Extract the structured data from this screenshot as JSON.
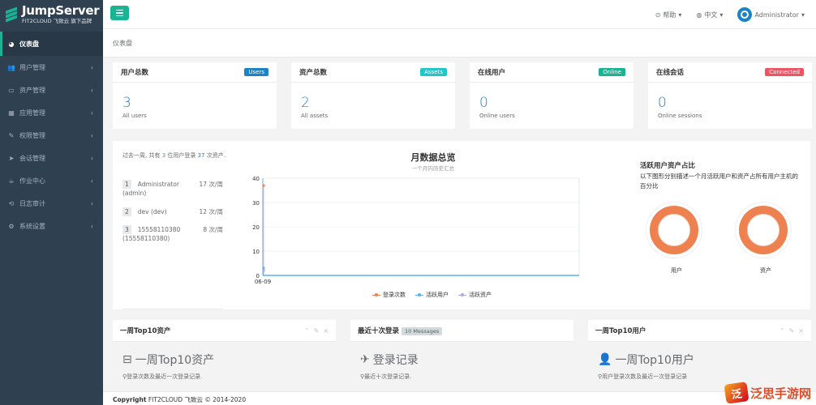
{
  "app": {
    "logo_title": "JumpServer",
    "logo_sub": "FIT2CLOUD 飞致云 旗下品牌"
  },
  "sidebar": {
    "items": [
      {
        "label": "仪表盘",
        "icon": "dashboard-icon",
        "glyph": "◕"
      },
      {
        "label": "用户管理",
        "icon": "users-icon",
        "glyph": "👥"
      },
      {
        "label": "资产管理",
        "icon": "inbox-icon",
        "glyph": "▭"
      },
      {
        "label": "应用管理",
        "icon": "grid-icon",
        "glyph": "▦"
      },
      {
        "label": "权限管理",
        "icon": "edit-icon",
        "glyph": "✎"
      },
      {
        "label": "会话管理",
        "icon": "rocket-icon",
        "glyph": "➤"
      },
      {
        "label": "作业中心",
        "icon": "coffee-icon",
        "glyph": "☕"
      },
      {
        "label": "日志审计",
        "icon": "history-icon",
        "glyph": "⟲"
      },
      {
        "label": "系统设置",
        "icon": "gears-icon",
        "glyph": "⚙"
      }
    ],
    "arrow": "‹"
  },
  "topbar": {
    "help": "帮助",
    "language": "中文",
    "user": "Administrator",
    "caret": "▾"
  },
  "breadcrumb": "仪表盘",
  "stats": [
    {
      "title": "用户总数",
      "badge": "Users",
      "badge_color": "#1c84c6",
      "value": "3",
      "sub": "All users"
    },
    {
      "title": "资产总数",
      "badge": "Assets",
      "badge_color": "#23c6c8",
      "value": "2",
      "sub": "All assets"
    },
    {
      "title": "在线用户",
      "badge": "Online",
      "badge_color": "#1ab394",
      "value": "0",
      "sub": "Online users"
    },
    {
      "title": "在线会话",
      "badge": "Connected",
      "badge_color": "#ed5565",
      "value": "0",
      "sub": "Online sessions"
    }
  ],
  "summary": {
    "prefix": "过去一周, 共有 ",
    "users": "3",
    "middle": " 位用户登录 ",
    "times": "37",
    "suffix": " 次资产."
  },
  "ranking": [
    {
      "no": "1",
      "name": "Administrator",
      "name2": "(admin)",
      "count": "17 次/周"
    },
    {
      "no": "2",
      "name": "dev (dev)",
      "name2": "",
      "count": "12 次/周"
    },
    {
      "no": "3",
      "name": "15558110380",
      "name2": "(15558110380)",
      "count": "8 次/周"
    }
  ],
  "chart_data": {
    "type": "line",
    "title": "月数据总览",
    "subtitle": "一个月内历史汇总",
    "x": [
      "06-09"
    ],
    "yticks": [
      "0",
      "10",
      "20",
      "30",
      "40"
    ],
    "ylim": [
      0,
      40
    ],
    "series": [
      {
        "name": "登录次数",
        "color": "#ed8250",
        "values": [
          37
        ]
      },
      {
        "name": "活跃用户",
        "color": "#5ab1ef",
        "values": [
          3
        ]
      },
      {
        "name": "活跃资产",
        "color": "#b6a2de",
        "values": [
          2
        ]
      }
    ]
  },
  "pies": {
    "title": "活跃用户资产占比",
    "desc": "以下图形分别描述一个月活跃用户和资产占所有用户主机的百分比",
    "labels": [
      "用户",
      "资产"
    ]
  },
  "bottom": [
    {
      "title": "一周Top10资产",
      "badge": "",
      "big": "一周Top10资产",
      "small": "登录次数及最近一次登录记录.",
      "icon": "hdd-icon",
      "glyph": "⊟"
    },
    {
      "title": "最近十次登录",
      "badge": "10 Messages",
      "big": "登录记录",
      "small": "最近十次登录记录.",
      "icon": "paper-plane-icon",
      "glyph": "✈"
    },
    {
      "title": "一周Top10用户",
      "badge": "",
      "big": "一周Top10用户",
      "small": "用户登录次数及最近一次登录记录",
      "icon": "user-icon",
      "glyph": "👤"
    }
  ],
  "tools": {
    "collapse": "⌃",
    "wrench": "✎",
    "close": "×"
  },
  "pin_glyph": "⚲",
  "footer": {
    "bold": "Copyright",
    "text": " FIT2CLOUD 飞致云 © 2014-2020"
  },
  "watermark": {
    "logo": "泛",
    "text": "泛思手游网"
  }
}
